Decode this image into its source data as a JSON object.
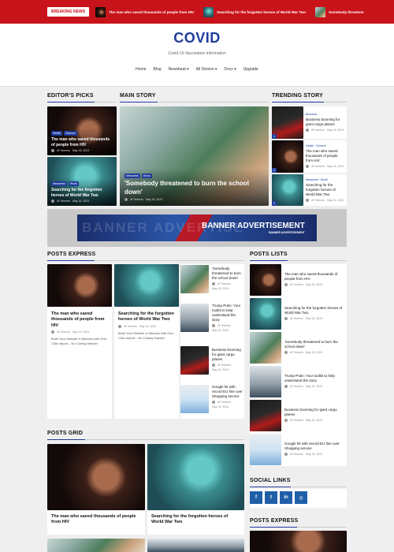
{
  "topbar": {
    "breaking_label": "BREAKING NEWS",
    "items": [
      {
        "title": "The man who saved thousands of people from HIV"
      },
      {
        "title": "Searching for the forgotten heroes of World War Two"
      },
      {
        "title": "Somebody threatene"
      }
    ]
  },
  "header": {
    "logo": "COVID",
    "tagline": "Covid-19 Vaccination Information",
    "nav": [
      "Home",
      "Blog",
      "Newsbeat ▾",
      "All Demos ▾",
      "Docs ▾",
      "Upgrade"
    ]
  },
  "editors_picks": {
    "heading": "EDITOR'S PICKS",
    "items": [
      {
        "tags": [
          "Health",
          "Science"
        ],
        "title": "The man who saved thousands of people from HIV",
        "author": "AF themes",
        "date": "May 16, 2024"
      },
      {
        "tags": [
          "Newsbeat",
          "World"
        ],
        "title": "Searching for the forgotten heroes of World War Two",
        "author": "AF themes",
        "date": "May 16, 2024"
      }
    ]
  },
  "main_story": {
    "heading": "MAIN STORY",
    "tags": [
      "Newsbeat",
      "World"
    ],
    "title": "'Somebody threatened to burn the school down'",
    "author": "AF themes",
    "date": "May 16, 2024"
  },
  "trending": {
    "heading": "TRENDING STORY",
    "items": [
      {
        "num": "1",
        "tags": "Business",
        "title": "Business booming for giant cargo planes",
        "author": "AF themes",
        "date": "May 16, 2024"
      },
      {
        "num": "2",
        "tags": "Health  ·  Science",
        "title": "The man who saved thousands of people from HIV",
        "author": "AF themes",
        "date": "May 16, 2024"
      },
      {
        "num": "3",
        "tags": "Newsbeat  ·  World",
        "title": "Searching for the forgotten heroes of World War Two",
        "author": "AF themes",
        "date": "May 16, 2024"
      }
    ]
  },
  "banner": {
    "ghost": "BANNER ADVERTISE",
    "title": "BANNER ADVERTISEMENT",
    "sub": "BANNER ADVERTISEMENT"
  },
  "posts_express": {
    "heading": "POSTS EXPRESS",
    "big": [
      {
        "title": "The man who saved thousands of people from HIV",
        "author": "AF themes",
        "date": "May 16, 2024",
        "desc": "Build Your Website in Minutes with One-Click Import – No Coding Hassle!"
      },
      {
        "title": "Searching for the forgotten heroes of World War Two",
        "author": "AF themes",
        "date": "May 16, 2024",
        "desc": "Build Your Website in Minutes with One-Click Import – No Coding Hassle!"
      }
    ],
    "small": [
      {
        "title": "'Somebody threatened to burn the school down'",
        "author": "AF themes",
        "date": "May 16, 2024"
      },
      {
        "title": "Trump-Putin: Your toolkit to help understand the story",
        "author": "AF themes",
        "date": "May 16, 2024"
      },
      {
        "title": "Business booming for giant cargo planes",
        "author": "AF themes",
        "date": "May 16, 2024"
      },
      {
        "title": "Google hit with record EU fine over Shopping service",
        "author": "AF themes",
        "date": "May 16, 2024"
      }
    ]
  },
  "posts_lists": {
    "heading": "POSTS LISTS",
    "items": [
      {
        "title": "The man who saved thousands of people from HIV",
        "author": "AF themes",
        "date": "May 16, 2024"
      },
      {
        "title": "Searching for the forgotten heroes of World War Two",
        "author": "AF themes",
        "date": "May 16, 2024"
      },
      {
        "title": "'Somebody threatened to burn the school down'",
        "author": "AF themes",
        "date": "May 16, 2024"
      },
      {
        "title": "Trump-Putin: Your toolkit to help understand the story",
        "author": "AF themes",
        "date": "May 16, 2024"
      },
      {
        "title": "Business booming for giant cargo planes",
        "author": "AF themes",
        "date": "May 16, 2024"
      },
      {
        "title": "Google hit with record EU fine over Shopping service",
        "author": "AF themes",
        "date": "May 16, 2024"
      }
    ]
  },
  "posts_grid": {
    "heading": "POSTS GRID",
    "items": [
      {
        "title": "The man who saved thousands of people from HIV"
      },
      {
        "title": "Searching for the forgotten heroes of World War Two"
      }
    ]
  },
  "social_links": {
    "heading": "SOCIAL LINKS",
    "icons": [
      {
        "name": "facebook-icon",
        "glyph": "f"
      },
      {
        "name": "twitter-icon",
        "glyph": "t"
      },
      {
        "name": "linkedin-icon",
        "glyph": "in"
      },
      {
        "name": "instagram-icon",
        "glyph": "◎"
      }
    ]
  },
  "posts_express_2": {
    "heading": "POSTS EXPRESS"
  },
  "colors": {
    "brand_red": "#c8131a",
    "brand_blue": "#1f3c9c"
  }
}
